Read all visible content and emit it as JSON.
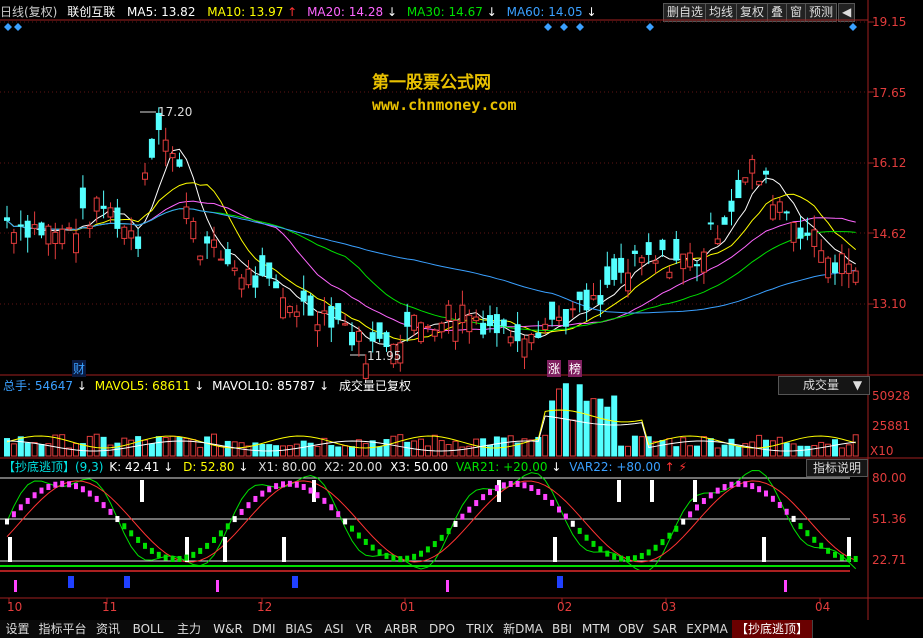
{
  "header": {
    "period": "日线(复权)",
    "name": "联创互联",
    "ma5": "MA5: 13.82",
    "ma10": "MA10: 13.97",
    "ma20": "MA20: 14.28",
    "ma30": "MA30: 14.67",
    "ma60": "MA60: 14.05"
  },
  "toolbar": [
    "删自选",
    "均线",
    "复权",
    "叠",
    "窗",
    "预测"
  ],
  "watermark": {
    "title": "第一股票公式网",
    "url": "www.chnmoney.com"
  },
  "price_axis": [
    "19.15",
    "17.65",
    "16.12",
    "14.62",
    "13.10"
  ],
  "annotations": {
    "high": "17.20",
    "low": "11.95",
    "fin": "财",
    "zhang": "涨",
    "bang": "榜"
  },
  "volume": {
    "total": "总手: 54647",
    "mavol5": "MAVOL5: 68611",
    "mavol10": "MAVOL10: 85787",
    "note": "成交量已复权",
    "selector": "成交量",
    "axis": [
      "50928",
      "25881"
    ],
    "unit": "X10"
  },
  "indicator": {
    "name": "【抄底逃顶】(9,3)",
    "k": "K: 42.41",
    "d": "D: 52.80",
    "x1": "X1: 80.00",
    "x2": "X2: 20.00",
    "x3": "X3: 50.00",
    "var21": "VAR21: +20.00",
    "var22": "VAR22: +80.00",
    "help": "指标说明",
    "axis": [
      "80.00",
      "51.36",
      "22.71"
    ]
  },
  "months": [
    "10",
    "11",
    "12",
    "01",
    "02",
    "03",
    "04"
  ],
  "tabs": [
    "设置",
    "指标平台",
    "资讯",
    "BOLL",
    "主力",
    "W&R",
    "DMI",
    "BIAS",
    "ASI",
    "VR",
    "ARBR",
    "DPO",
    "TRIX",
    "新DMA",
    "BBI",
    "MTM",
    "OBV",
    "SAR",
    "EXPMA",
    "【抄底逃顶】"
  ],
  "colors": {
    "up": "#e23c3c",
    "down": "#54ffff",
    "ma5": "#ffffff",
    "ma10": "#ffff00",
    "ma20": "#ff66ff",
    "ma30": "#00e000",
    "ma60": "#3aa0ff"
  }
}
